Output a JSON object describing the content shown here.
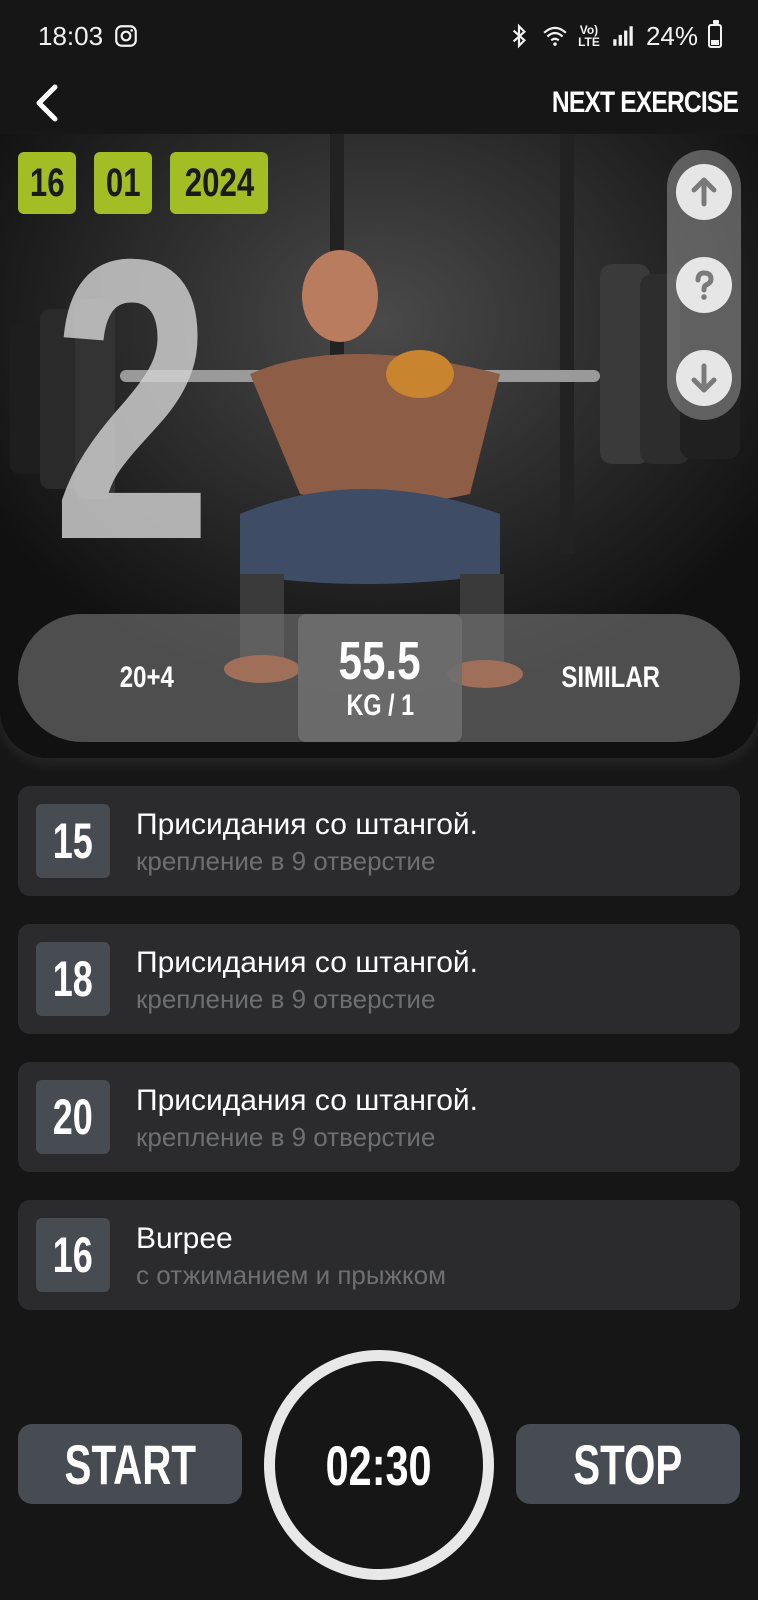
{
  "status_bar": {
    "time": "18:03",
    "battery": "24%",
    "battery_level": 0.24,
    "icons": [
      "instagram-icon",
      "bluetooth-icon",
      "wifi-icon",
      "volte-icon",
      "signal-icon",
      "battery-icon"
    ],
    "lte_label": "LTE"
  },
  "nav": {
    "next_label": "NEXT EXERCISE"
  },
  "hero": {
    "date": {
      "day": "16",
      "month": "01",
      "year": "2024"
    },
    "set_number": "2",
    "reps": "20+4",
    "weight": "55.5",
    "unit": "KG / 1",
    "similar_label": "SIMILAR"
  },
  "exercises": [
    {
      "reps": "15",
      "title": "Присидания со штангой.",
      "subtitle": "крепление в 9 отверстие"
    },
    {
      "reps": "18",
      "title": "Присидания со штангой.",
      "subtitle": "крепление в 9 отверстие"
    },
    {
      "reps": "20",
      "title": "Присидания со штангой.",
      "subtitle": "крепление в 9 отверстие"
    },
    {
      "reps": "16",
      "title": "Burpee",
      "subtitle": "с отжиманием и прыжком"
    }
  ],
  "controls": {
    "start_label": "START",
    "timer": "02:30",
    "stop_label": "STOP"
  },
  "colors": {
    "accent": "#a2be24",
    "background": "#161616",
    "card": "#2b2b2d",
    "button": "#474b52",
    "subtitle": "#6d6f73"
  }
}
